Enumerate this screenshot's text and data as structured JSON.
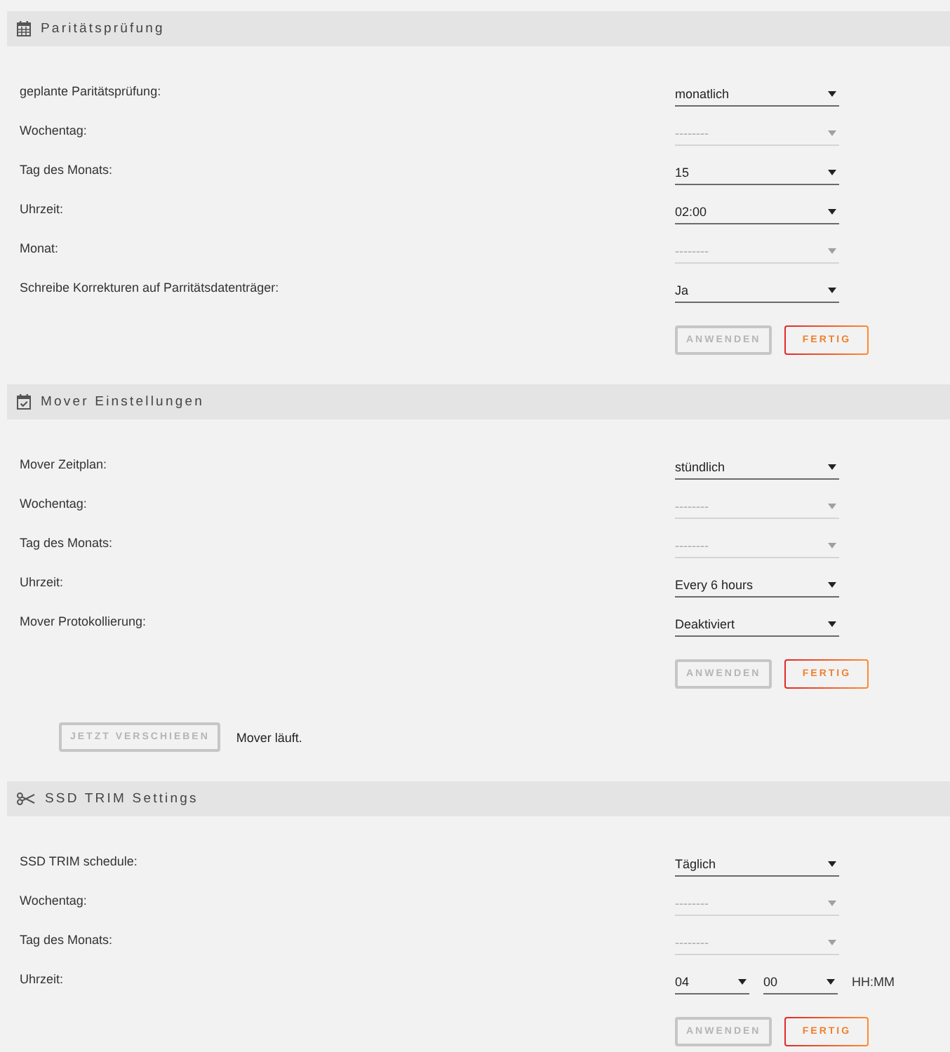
{
  "sections": [
    {
      "kind": "parity",
      "title": "Paritätsprüfung",
      "rows": [
        {
          "label": "geplante Paritätsprüfung:",
          "selects": [
            {
              "value": "monatlich",
              "disabled": false
            }
          ]
        },
        {
          "label": "Wochentag:",
          "selects": [
            {
              "value": "--------",
              "disabled": true
            }
          ]
        },
        {
          "label": "Tag des Monats:",
          "selects": [
            {
              "value": "15",
              "disabled": false
            }
          ]
        },
        {
          "label": "Uhrzeit:",
          "selects": [
            {
              "value": "02:00",
              "disabled": false
            }
          ]
        },
        {
          "label": "Monat:",
          "selects": [
            {
              "value": "--------",
              "disabled": true
            }
          ]
        },
        {
          "label": "Schreibe Korrekturen auf Parritätsdatenträger:",
          "selects": [
            {
              "value": "Ja",
              "disabled": false
            }
          ]
        }
      ],
      "buttons": [
        {
          "label": "ANWENDEN",
          "disabled": true
        },
        {
          "label": "FERTIG",
          "disabled": false
        }
      ]
    },
    {
      "kind": "mover",
      "title": "Mover Einstellungen",
      "rows": [
        {
          "label": "Mover Zeitplan:",
          "selects": [
            {
              "value": "stündlich",
              "disabled": false
            }
          ]
        },
        {
          "label": "Wochentag:",
          "selects": [
            {
              "value": "--------",
              "disabled": true
            }
          ]
        },
        {
          "label": "Tag des Monats:",
          "selects": [
            {
              "value": "--------",
              "disabled": true
            }
          ]
        },
        {
          "label": "Uhrzeit:",
          "selects": [
            {
              "value": "Every 6 hours",
              "disabled": false
            }
          ]
        },
        {
          "label": "Mover Protokollierung:",
          "selects": [
            {
              "value": "Deaktiviert",
              "disabled": false
            }
          ]
        }
      ],
      "buttons": [
        {
          "label": "ANWENDEN",
          "disabled": true
        },
        {
          "label": "FERTIG",
          "disabled": false
        }
      ],
      "move_now": {
        "button": {
          "label": "JETZT VERSCHIEBEN",
          "disabled": true
        },
        "status": "Mover läuft."
      }
    },
    {
      "kind": "trim",
      "title": "SSD TRIM Settings",
      "rows": [
        {
          "label": "SSD TRIM schedule:",
          "selects": [
            {
              "value": "Täglich",
              "disabled": false
            }
          ]
        },
        {
          "label": "Wochentag:",
          "selects": [
            {
              "value": "--------",
              "disabled": true
            }
          ]
        },
        {
          "label": "Tag des Monats:",
          "selects": [
            {
              "value": "--------",
              "disabled": true
            }
          ]
        },
        {
          "label": "Uhrzeit:",
          "selects": [
            {
              "value": "04",
              "disabled": false
            },
            {
              "value": "00",
              "disabled": false
            }
          ],
          "unit": "HH:MM"
        }
      ],
      "buttons": [
        {
          "label": "ANWENDEN",
          "disabled": true
        },
        {
          "label": "FERTIG",
          "disabled": false
        }
      ]
    }
  ]
}
